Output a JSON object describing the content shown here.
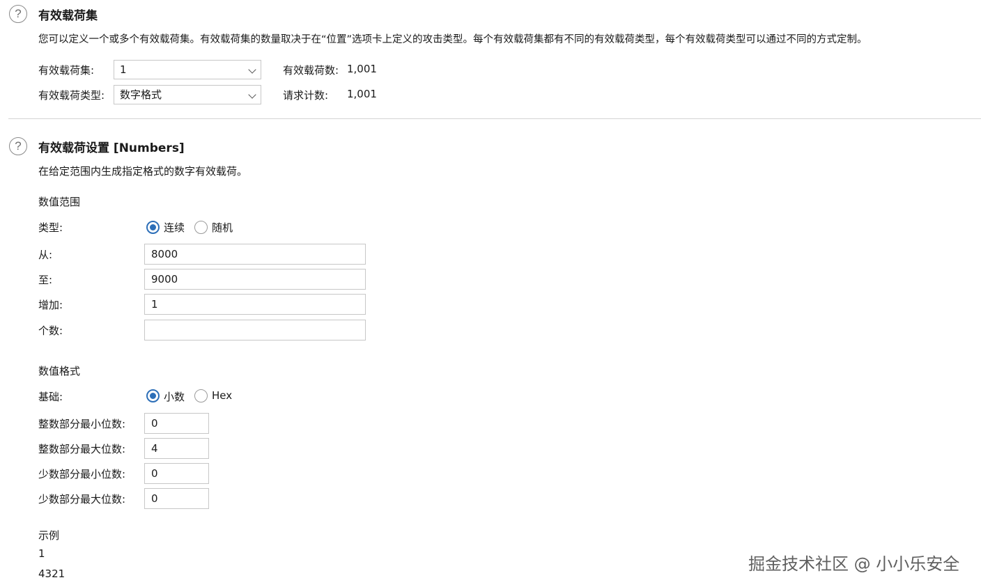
{
  "payload_sets": {
    "title": "有效载荷集",
    "description": "您可以定义一个或多个有效载荷集。有效载荷集的数量取决于在“位置”选项卡上定义的攻击类型。每个有效载荷集都有不同的有效载荷类型，每个有效载荷类型可以通过不同的方式定制。",
    "set_label": "有效载荷集:",
    "set_value": "1",
    "type_label": "有效载荷类型:",
    "type_value": "数字格式",
    "count_label": "有效载荷数:",
    "count_value": "1,001",
    "request_label": "请求计数:",
    "request_value": "1,001"
  },
  "payload_settings": {
    "title": "有效载荷设置 [Numbers]",
    "description": "在给定范围内生成指定格式的数字有效载荷。",
    "range": {
      "heading": "数值范围",
      "type_label": "类型:",
      "option_sequential": "连续",
      "option_random": "随机",
      "selected": "连续",
      "from_label": "从:",
      "from_value": "8000",
      "to_label": "至:",
      "to_value": "9000",
      "step_label": "增加:",
      "step_value": "1",
      "howmany_label": "个数:",
      "howmany_value": ""
    },
    "format": {
      "heading": "数值格式",
      "base_label": "基础:",
      "option_decimal": "小数",
      "option_hex": "Hex",
      "selected": "小数",
      "min_int_label": "整数部分最小位数:",
      "min_int_value": "0",
      "max_int_label": "整数部分最大位数:",
      "max_int_value": "4",
      "min_frac_label": "少数部分最小位数:",
      "min_frac_value": "0",
      "max_frac_label": "少数部分最大位数:",
      "max_frac_value": "0"
    },
    "examples": {
      "heading": "示例",
      "items": [
        "1",
        "4321"
      ]
    }
  },
  "watermark": "掘金技术社区 @ 小小乐安全"
}
